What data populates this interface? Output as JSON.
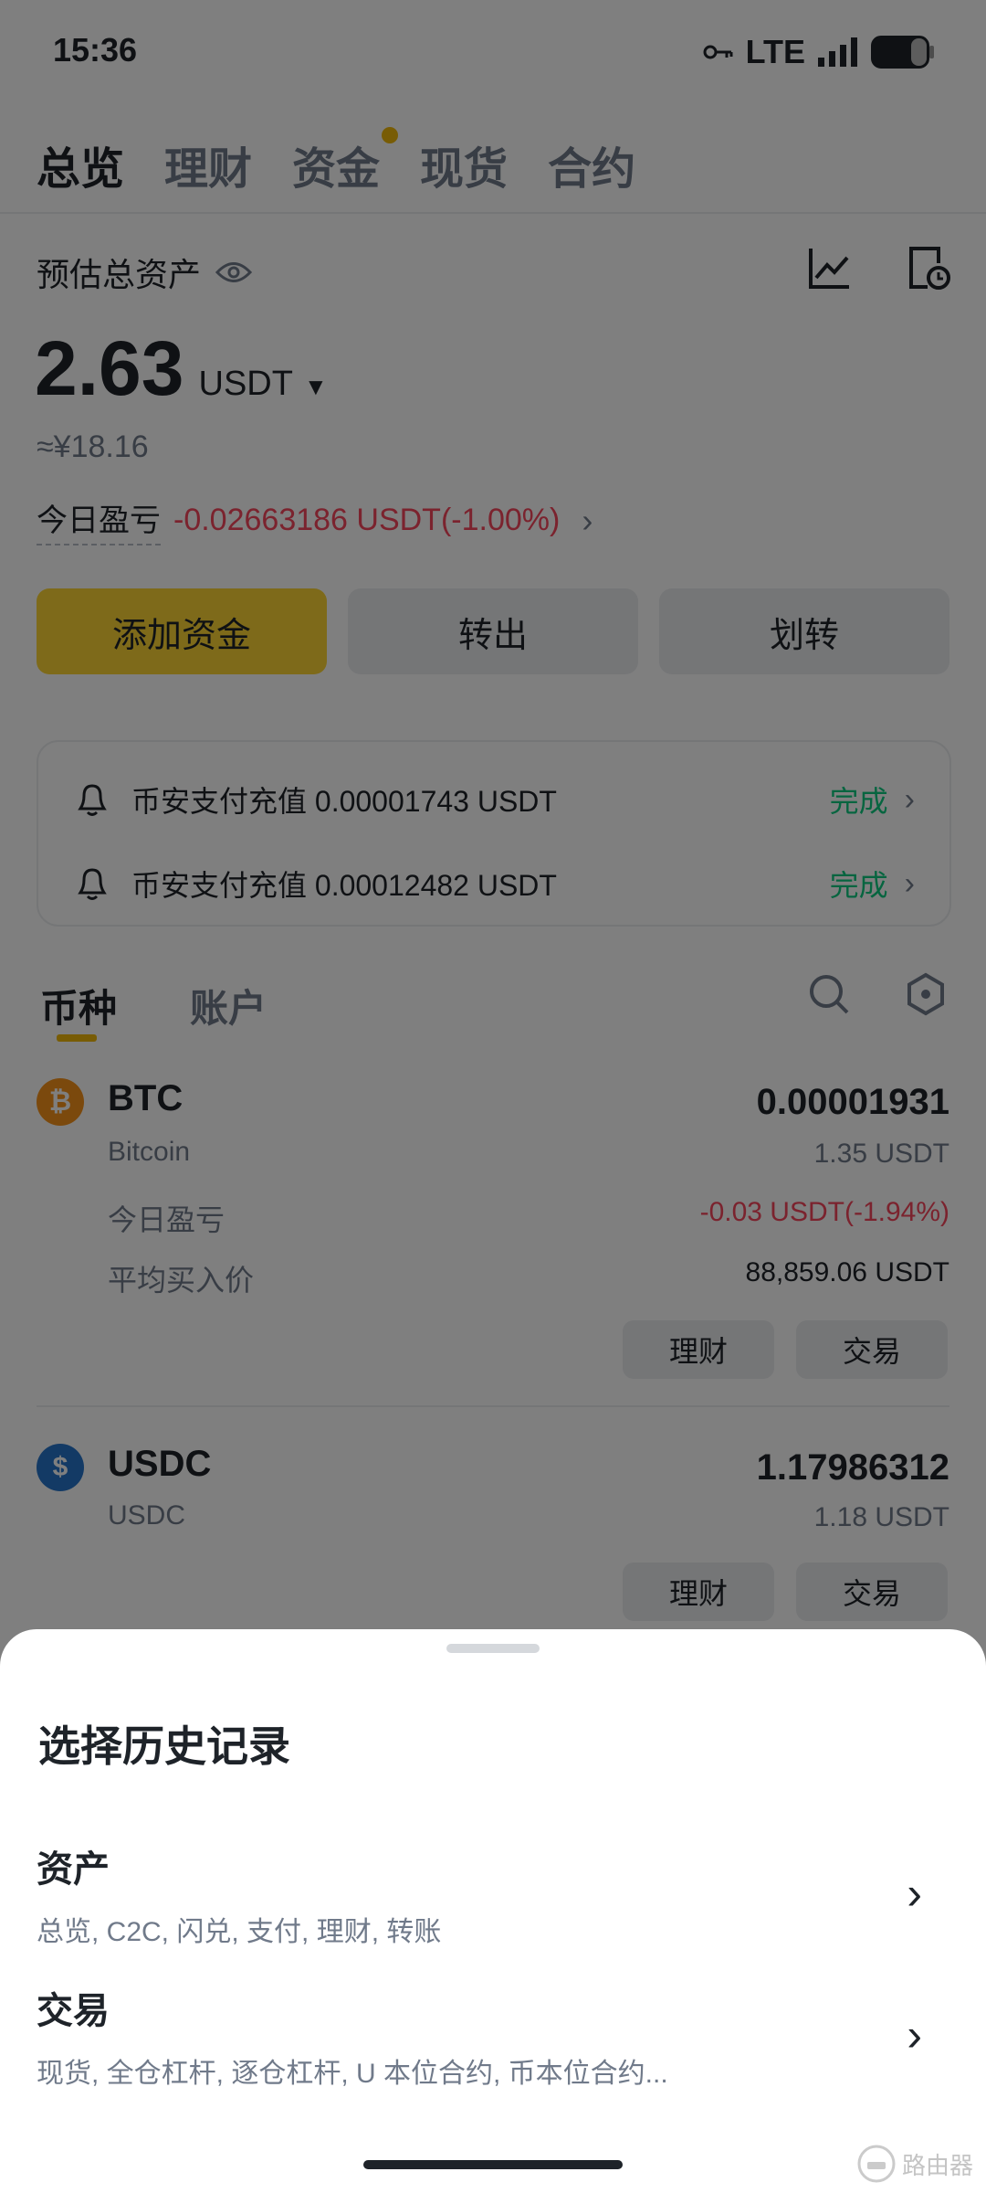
{
  "status_bar": {
    "time": "15:36",
    "network": "LTE"
  },
  "top_tabs": [
    "总览",
    "理财",
    "资金",
    "现货",
    "合约"
  ],
  "summary": {
    "label": "预估总资产",
    "amount": "2.63",
    "unit": "USDT",
    "approx": "≈¥18.16",
    "pnl_label": "今日盈亏",
    "pnl_value": "-0.02663186 USDT(-1.00%)"
  },
  "actions": {
    "add_funds": "添加资金",
    "withdraw": "转出",
    "transfer": "划转"
  },
  "notices": [
    {
      "text": "币安支付充值 0.00001743 USDT",
      "status": "完成"
    },
    {
      "text": "币安支付充值 0.00012482 USDT",
      "status": "完成"
    }
  ],
  "asset_tabs": {
    "coins": "币种",
    "account": "账户"
  },
  "coins": [
    {
      "symbol": "BTC",
      "name": "Bitcoin",
      "amount": "0.00001931",
      "value": "1.35 USDT",
      "pnl_label": "今日盈亏",
      "pnl": "-0.03 USDT(-1.94%)",
      "avg_label": "平均买入价",
      "avg": "88,859.06 USDT",
      "earn": "理财",
      "trade": "交易"
    },
    {
      "symbol": "USDC",
      "name": "USDC",
      "amount": "1.17986312",
      "value": "1.18 USDT",
      "earn": "理财",
      "trade": "交易"
    }
  ],
  "sheet": {
    "title": "选择历史记录",
    "items": [
      {
        "title": "资产",
        "subtitle": "总览, C2C, 闪兑, 支付, 理财, 转账"
      },
      {
        "title": "交易",
        "subtitle": "现货, 全仓杠杆, 逐仓杠杆, U 本位合约, 币本位合约..."
      }
    ]
  },
  "watermark": "路由器",
  "colors": {
    "brand_yellow": "#fcd535",
    "negative": "#f6465d",
    "positive": "#0ecb81"
  }
}
